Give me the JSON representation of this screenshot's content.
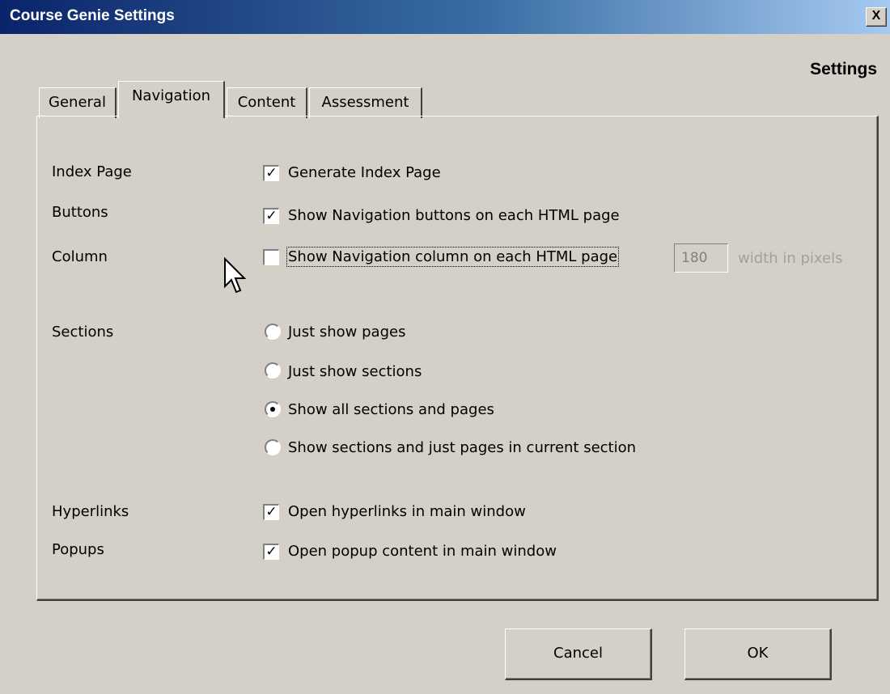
{
  "window": {
    "title": "Course Genie Settings",
    "close_label": "X"
  },
  "heading": "Settings",
  "tabs": [
    {
      "label": "General",
      "active": false
    },
    {
      "label": "Navigation",
      "active": true
    },
    {
      "label": "Content",
      "active": false
    },
    {
      "label": "Assessment",
      "active": false
    }
  ],
  "rows": {
    "index_page": {
      "label": "Index Page",
      "option": "Generate Index Page",
      "checked": true
    },
    "buttons": {
      "label": "Buttons",
      "option": "Show Navigation buttons on each HTML page",
      "checked": true
    },
    "column": {
      "label": "Column",
      "option": "Show Navigation column on each HTML page",
      "checked": false,
      "width_value": "180",
      "width_suffix": "width in pixels"
    },
    "sections": {
      "label": "Sections",
      "options": [
        {
          "label": "Just show pages",
          "selected": false
        },
        {
          "label": "Just show sections",
          "selected": false
        },
        {
          "label": "Show all sections and pages",
          "selected": true
        },
        {
          "label": "Show sections and just pages in current section",
          "selected": false
        }
      ]
    },
    "hyperlinks": {
      "label": "Hyperlinks",
      "option": "Open hyperlinks in main window",
      "checked": true
    },
    "popups": {
      "label": "Popups",
      "option": "Open popup content in main window",
      "checked": true
    }
  },
  "buttons": {
    "cancel": "Cancel",
    "ok": "OK"
  },
  "icons": {
    "checked": "checkmark-icon",
    "cursor": "arrow-cursor-icon"
  }
}
